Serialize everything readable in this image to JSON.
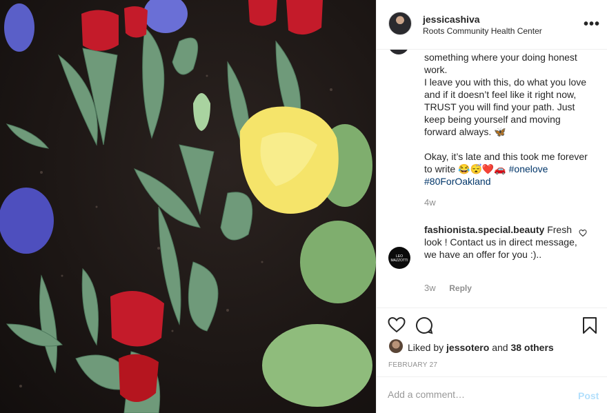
{
  "post": {
    "header": {
      "username": "jessicashiva",
      "location": "Roots Community Health Center",
      "more_icon": "more-horizontal-icon"
    },
    "caption": {
      "lines": [
        "something where your doing honest work.",
        "I leave you with this, do what you love and if it doesn’t feel like it right now, TRUST you will find your path. Just keep being yourself and moving forward always. 🦋",
        "",
        "Okay, it’s late and this took me forever to write 😂😴❤️🚗"
      ],
      "hashtags": [
        "#onelove",
        "#80ForOakland"
      ],
      "age": "4w"
    },
    "comments": [
      {
        "username": "fashionista.special.beauty",
        "text": "Fresh look ! Contact us in direct message, we have an offer for you :)..",
        "age": "3w",
        "reply_label": "Reply",
        "avatar_text": "LEO MAZZOTTI"
      }
    ],
    "likes": {
      "prefix": "Liked by",
      "user": "jessotero",
      "connector": "and",
      "others": "38 others"
    },
    "date": "FEBRUARY 27",
    "add_comment": {
      "placeholder": "Add a comment…",
      "post_label": "Post"
    }
  }
}
